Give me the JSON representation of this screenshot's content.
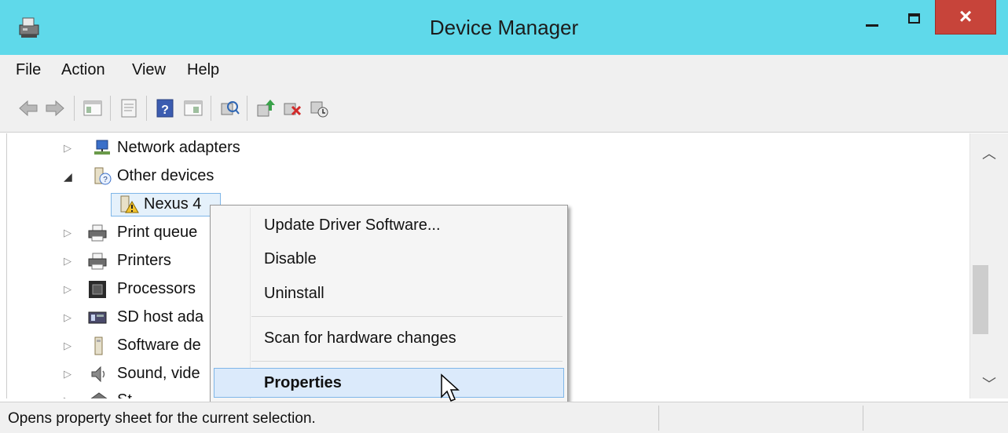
{
  "window": {
    "title": "Device Manager",
    "close_glyph": "×"
  },
  "menu": [
    "File",
    "Action",
    "View",
    "Help"
  ],
  "toolbar": [
    "back-arrow-icon",
    "forward-arrow-icon",
    "show-hide-console-tree-icon",
    "properties-icon",
    "help-icon",
    "action-pane-icon",
    "scan-hardware-icon",
    "update-driver-icon",
    "uninstall-icon",
    "enable-device-icon"
  ],
  "tree": {
    "items": [
      {
        "label": "Network adapters",
        "icon": "network-adapter-icon",
        "expanded": false
      },
      {
        "label": "Other devices",
        "icon": "other-devices-icon",
        "expanded": true
      },
      {
        "label": "Nexus 4",
        "icon": "warning-device-icon",
        "selected": true
      },
      {
        "label": "Print queue",
        "icon": "print-queue-icon",
        "expanded": false
      },
      {
        "label": "Printers",
        "icon": "printer-icon",
        "expanded": false
      },
      {
        "label": "Processors",
        "icon": "processor-icon",
        "expanded": false
      },
      {
        "label": "SD host ada",
        "icon": "sd-host-icon",
        "expanded": false
      },
      {
        "label": "Software de",
        "icon": "software-device-icon",
        "expanded": false
      },
      {
        "label": "Sound, vide",
        "icon": "sound-icon",
        "expanded": false
      },
      {
        "label": "St",
        "icon": "storage-icon",
        "expanded": false
      }
    ]
  },
  "context_menu": {
    "items": [
      "Update Driver Software...",
      "Disable",
      "Uninstall",
      "Scan for hardware changes",
      "Properties"
    ],
    "highlighted": "Properties"
  },
  "status": {
    "text": "Opens property sheet for the current selection."
  },
  "colors": {
    "titlebar": "#5fd9ea",
    "close_button": "#c7443a",
    "selection": "#e5f1fb",
    "selection_border": "#7fb6e8"
  }
}
